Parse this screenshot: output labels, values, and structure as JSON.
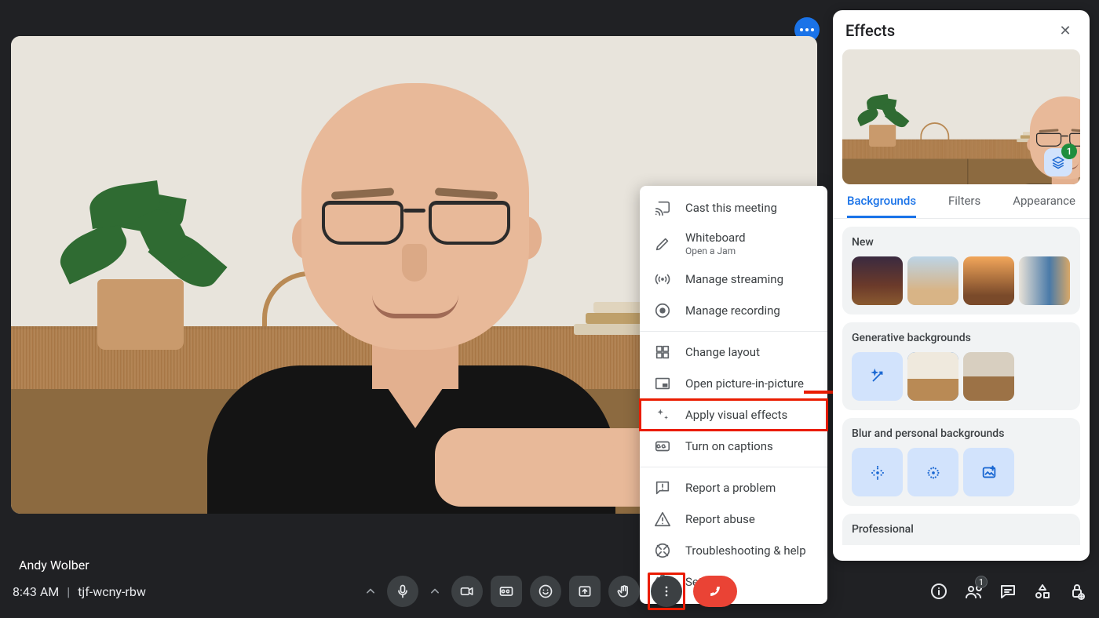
{
  "video_name": "Andy Wolber",
  "bottom": {
    "time": "8:43 AM",
    "meeting_code": "tjf-wcny-rbw",
    "people_count": "1"
  },
  "menu": {
    "cast": "Cast this meeting",
    "whiteboard": "Whiteboard",
    "whiteboard_sub": "Open a Jam",
    "streaming": "Manage streaming",
    "recording": "Manage recording",
    "layout": "Change layout",
    "pip": "Open picture-in-picture",
    "effects": "Apply visual effects",
    "captions": "Turn on captions",
    "report": "Report a problem",
    "abuse": "Report abuse",
    "help": "Troubleshooting & help",
    "settings": "Settings"
  },
  "effects": {
    "title": "Effects",
    "layer_count": "1",
    "tabs": {
      "bg": "Backgrounds",
      "filters": "Filters",
      "appearance": "Appearance"
    },
    "sec_new": "New",
    "sec_gen": "Generative backgrounds",
    "sec_blur": "Blur and personal backgrounds",
    "sec_pro": "Professional"
  }
}
